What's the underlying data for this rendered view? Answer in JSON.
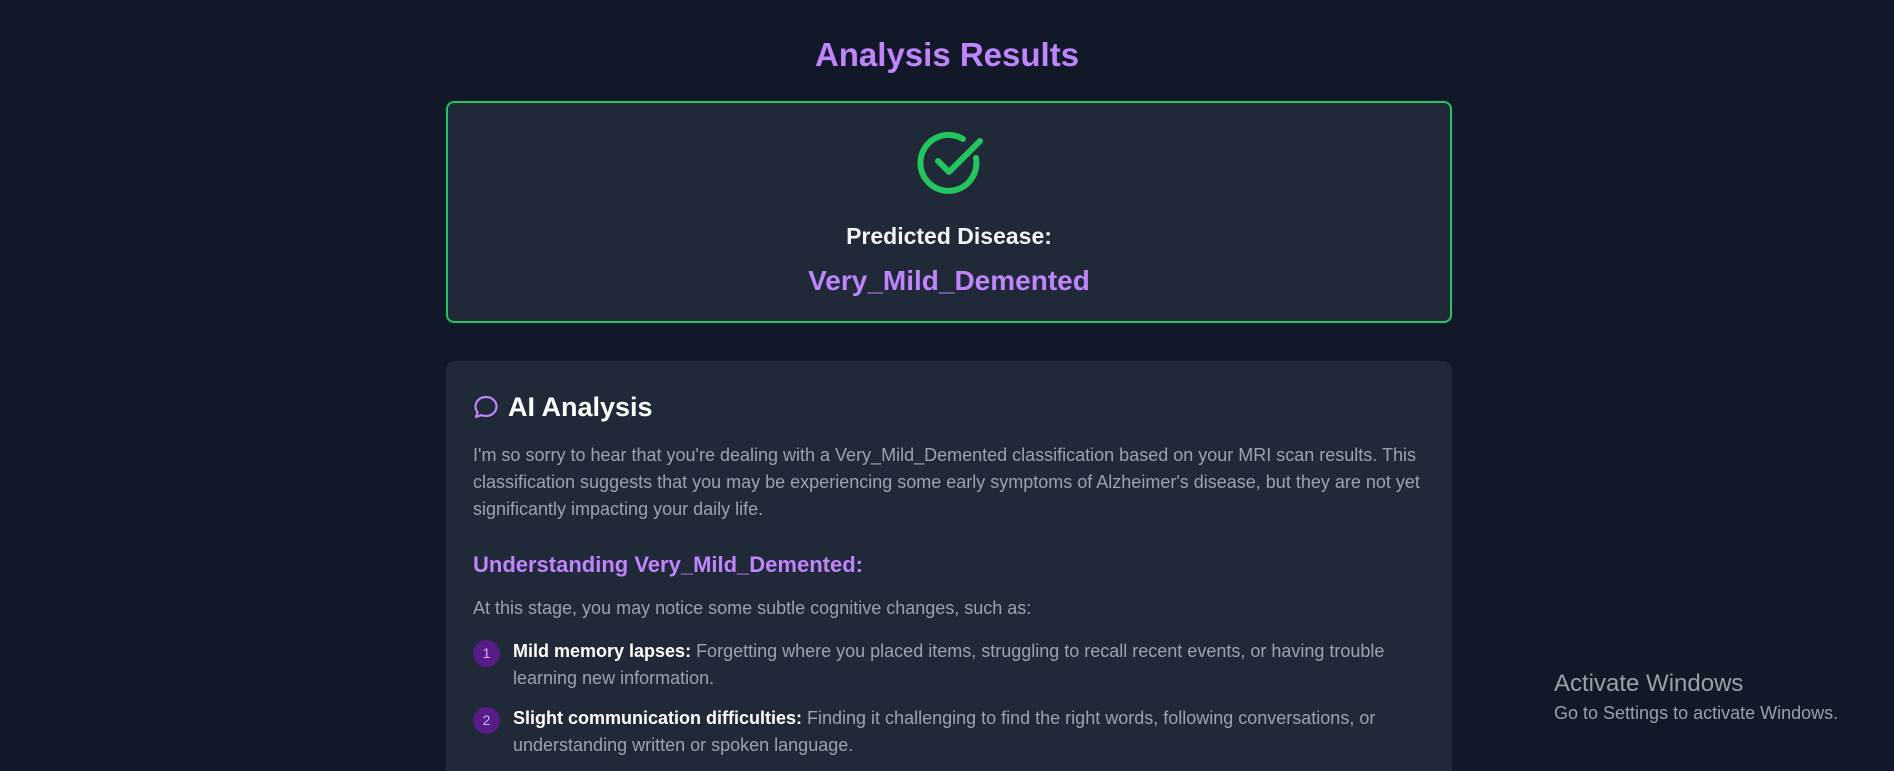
{
  "page": {
    "title": "Analysis Results"
  },
  "result": {
    "icon": "check-circle-icon",
    "label": "Predicted Disease:",
    "value": "Very_Mild_Demented"
  },
  "analysis": {
    "icon": "chat-bubble-icon",
    "title": "AI Analysis",
    "intro": "I'm so sorry to hear that you're dealing with a Very_Mild_Demented classification based on your MRI scan results. This classification suggests that you may be experiencing some early symptoms of Alzheimer's disease, but they are not yet significantly impacting your daily life.",
    "section_heading": "Understanding Very_Mild_Demented:",
    "section_intro": "At this stage, you may notice some subtle cognitive changes, such as:",
    "symptoms": [
      {
        "number": "1",
        "term": "Mild memory lapses:",
        "description": "Forgetting where you placed items, struggling to recall recent events, or having trouble learning new information."
      },
      {
        "number": "2",
        "term": "Slight communication difficulties:",
        "description": "Finding it challenging to find the right words, following conversations, or understanding written or spoken language."
      }
    ]
  },
  "watermark": {
    "title": "Activate Windows",
    "subtitle": "Go to Settings to activate Windows."
  },
  "colors": {
    "background": "#111827",
    "card": "#1f2937",
    "accent": "#c084fc",
    "success": "#22c55e",
    "text_muted": "#9ca3af"
  }
}
